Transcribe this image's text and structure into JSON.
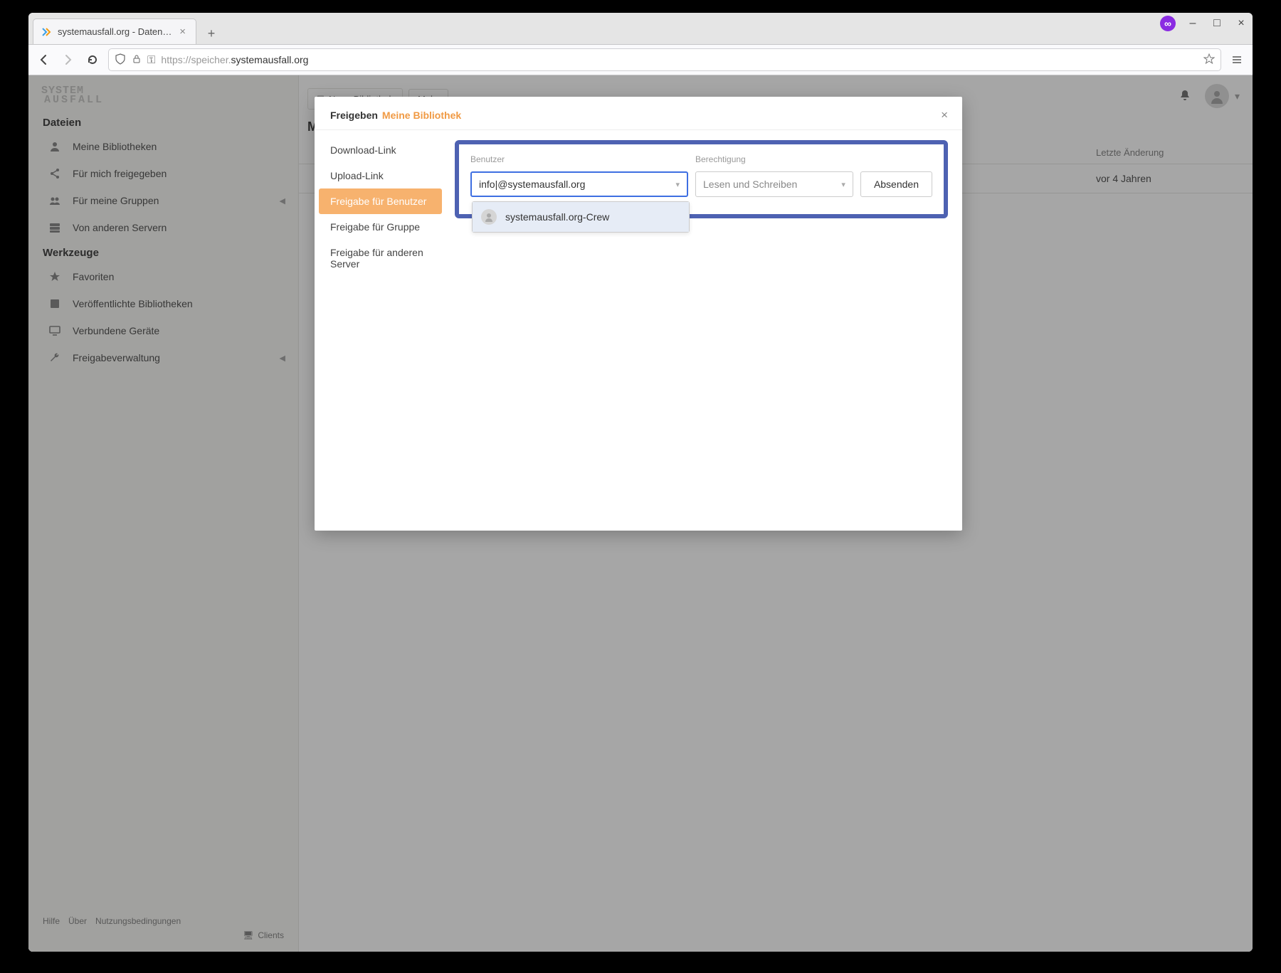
{
  "browser": {
    "tab_title": "systemausfall.org - Daten…",
    "url_prefix": "https://",
    "url_sub": "speicher.",
    "url_host": "systemausfall.org"
  },
  "window_controls": {
    "min": "–",
    "max": "□",
    "close": "×"
  },
  "sidebar": {
    "section_files": "Dateien",
    "files_items": [
      {
        "label": "Meine Bibliotheken",
        "icon": "person"
      },
      {
        "label": "Für mich freigegeben",
        "icon": "share"
      },
      {
        "label": "Für meine Gruppen",
        "icon": "group",
        "chev": true
      },
      {
        "label": "Von anderen Servern",
        "icon": "server"
      }
    ],
    "section_tools": "Werkzeuge",
    "tools_items": [
      {
        "label": "Favoriten",
        "icon": "star"
      },
      {
        "label": "Veröffentlichte Bibliotheken",
        "icon": "book"
      },
      {
        "label": "Verbundene Geräte",
        "icon": "monitor"
      },
      {
        "label": "Freigabeverwaltung",
        "icon": "wrench",
        "chev": true
      }
    ],
    "footer": {
      "help": "Hilfe",
      "about": "Über",
      "terms": "Nutzungsbedingungen",
      "clients": "Clients"
    }
  },
  "main": {
    "toolbar": {
      "new_lib": "Neue Bibliothek",
      "more": "Mehr"
    },
    "heading_initial": "M",
    "table": {
      "th_name": "",
      "th_date": "Letzte Änderung",
      "row_date": "vor 4 Jahren"
    }
  },
  "appbar": {
    "avatar_caret": "▾"
  },
  "modal": {
    "title_prefix": "Freigeben",
    "title_accent": "Meine Bibliothek",
    "close": "×",
    "nav": [
      "Download-Link",
      "Upload-Link",
      "Freigabe für Benutzer",
      "Freigabe für Gruppe",
      "Freigabe für anderen Server"
    ],
    "nav_active_index": 2,
    "form": {
      "label_user": "Benutzer",
      "label_perm": "Berechtigung",
      "user_value": "info|@systemausfall.org",
      "perm_value": "Lesen und Schreiben",
      "send": "Absenden",
      "dropdown_option": "systemausfall.org-Crew"
    }
  }
}
